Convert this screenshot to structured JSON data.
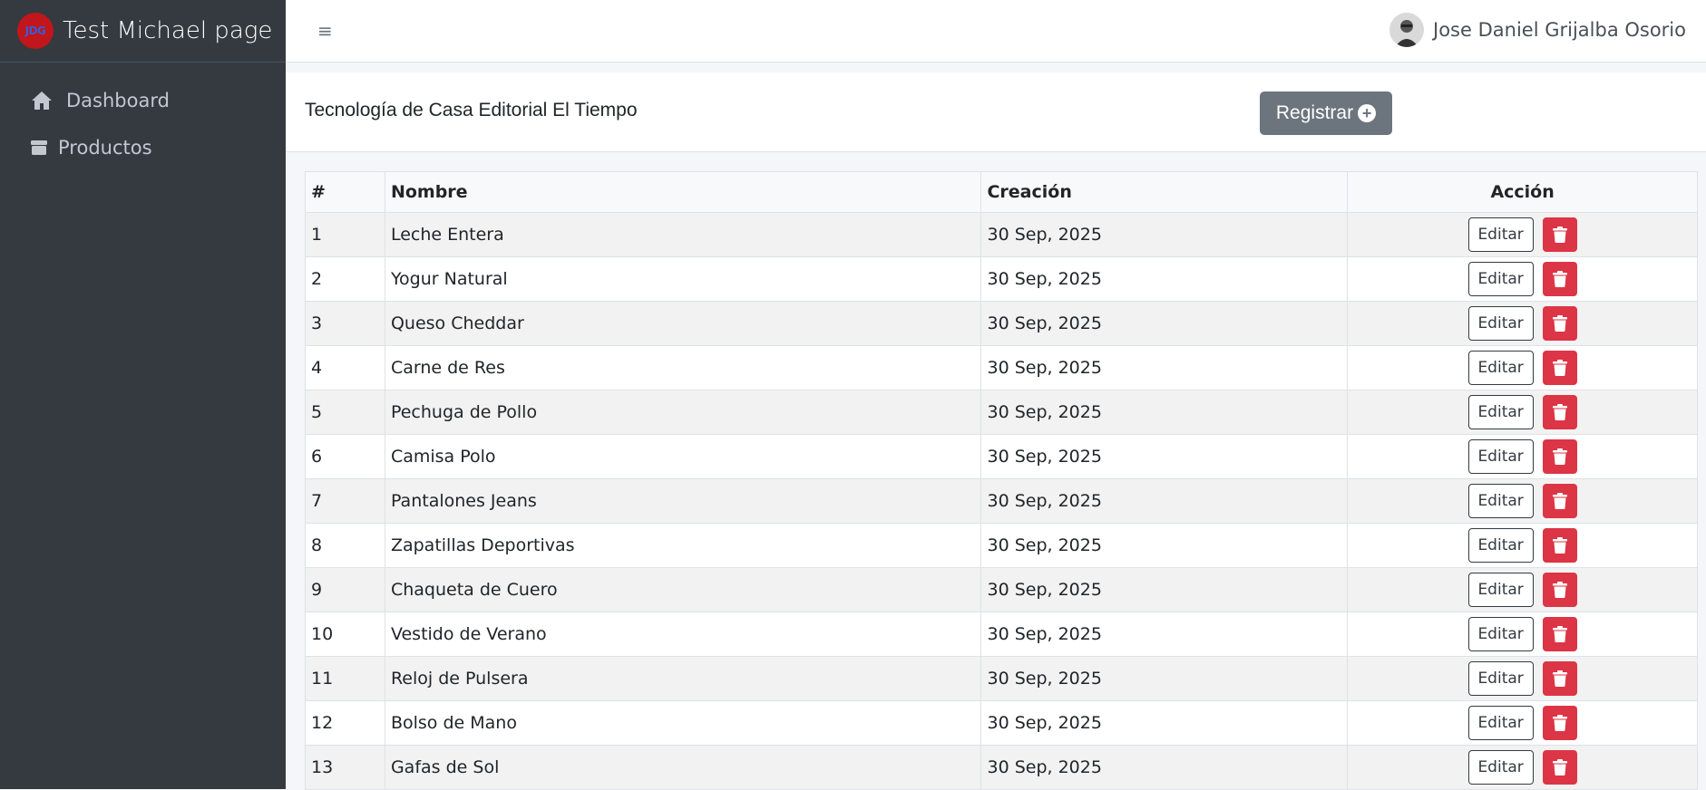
{
  "brand": {
    "logo_text": "JDG",
    "name": "Test Michael page"
  },
  "sidebar": {
    "items": [
      {
        "label": "Dashboard",
        "icon": "home-icon"
      },
      {
        "label": "Productos",
        "icon": "box-icon"
      }
    ]
  },
  "topbar": {
    "menu_icon": "hamburger-icon",
    "user_name": "Jose Daniel Grijalba Osorio"
  },
  "content": {
    "title": "Tecnología de Casa Editorial El Tiempo",
    "register_label": "Registrar"
  },
  "table": {
    "headers": [
      "#",
      "Nombre",
      "Creación",
      "Acción"
    ],
    "edit_label": "Editar",
    "rows": [
      {
        "id": "1",
        "name": "Leche Entera",
        "date": "30 Sep, 2025"
      },
      {
        "id": "2",
        "name": "Yogur Natural",
        "date": "30 Sep, 2025"
      },
      {
        "id": "3",
        "name": "Queso Cheddar",
        "date": "30 Sep, 2025"
      },
      {
        "id": "4",
        "name": "Carne de Res",
        "date": "30 Sep, 2025"
      },
      {
        "id": "5",
        "name": "Pechuga de Pollo",
        "date": "30 Sep, 2025"
      },
      {
        "id": "6",
        "name": "Camisa Polo",
        "date": "30 Sep, 2025"
      },
      {
        "id": "7",
        "name": "Pantalones Jeans",
        "date": "30 Sep, 2025"
      },
      {
        "id": "8",
        "name": "Zapatillas Deportivas",
        "date": "30 Sep, 2025"
      },
      {
        "id": "9",
        "name": "Chaqueta de Cuero",
        "date": "30 Sep, 2025"
      },
      {
        "id": "10",
        "name": "Vestido de Verano",
        "date": "30 Sep, 2025"
      },
      {
        "id": "11",
        "name": "Reloj de Pulsera",
        "date": "30 Sep, 2025"
      },
      {
        "id": "12",
        "name": "Bolso de Mano",
        "date": "30 Sep, 2025"
      },
      {
        "id": "13",
        "name": "Gafas de Sol",
        "date": "30 Sep, 2025"
      }
    ]
  },
  "colors": {
    "sidebar": "#343a40",
    "danger": "#dc3545",
    "secondary": "#6c757d"
  }
}
